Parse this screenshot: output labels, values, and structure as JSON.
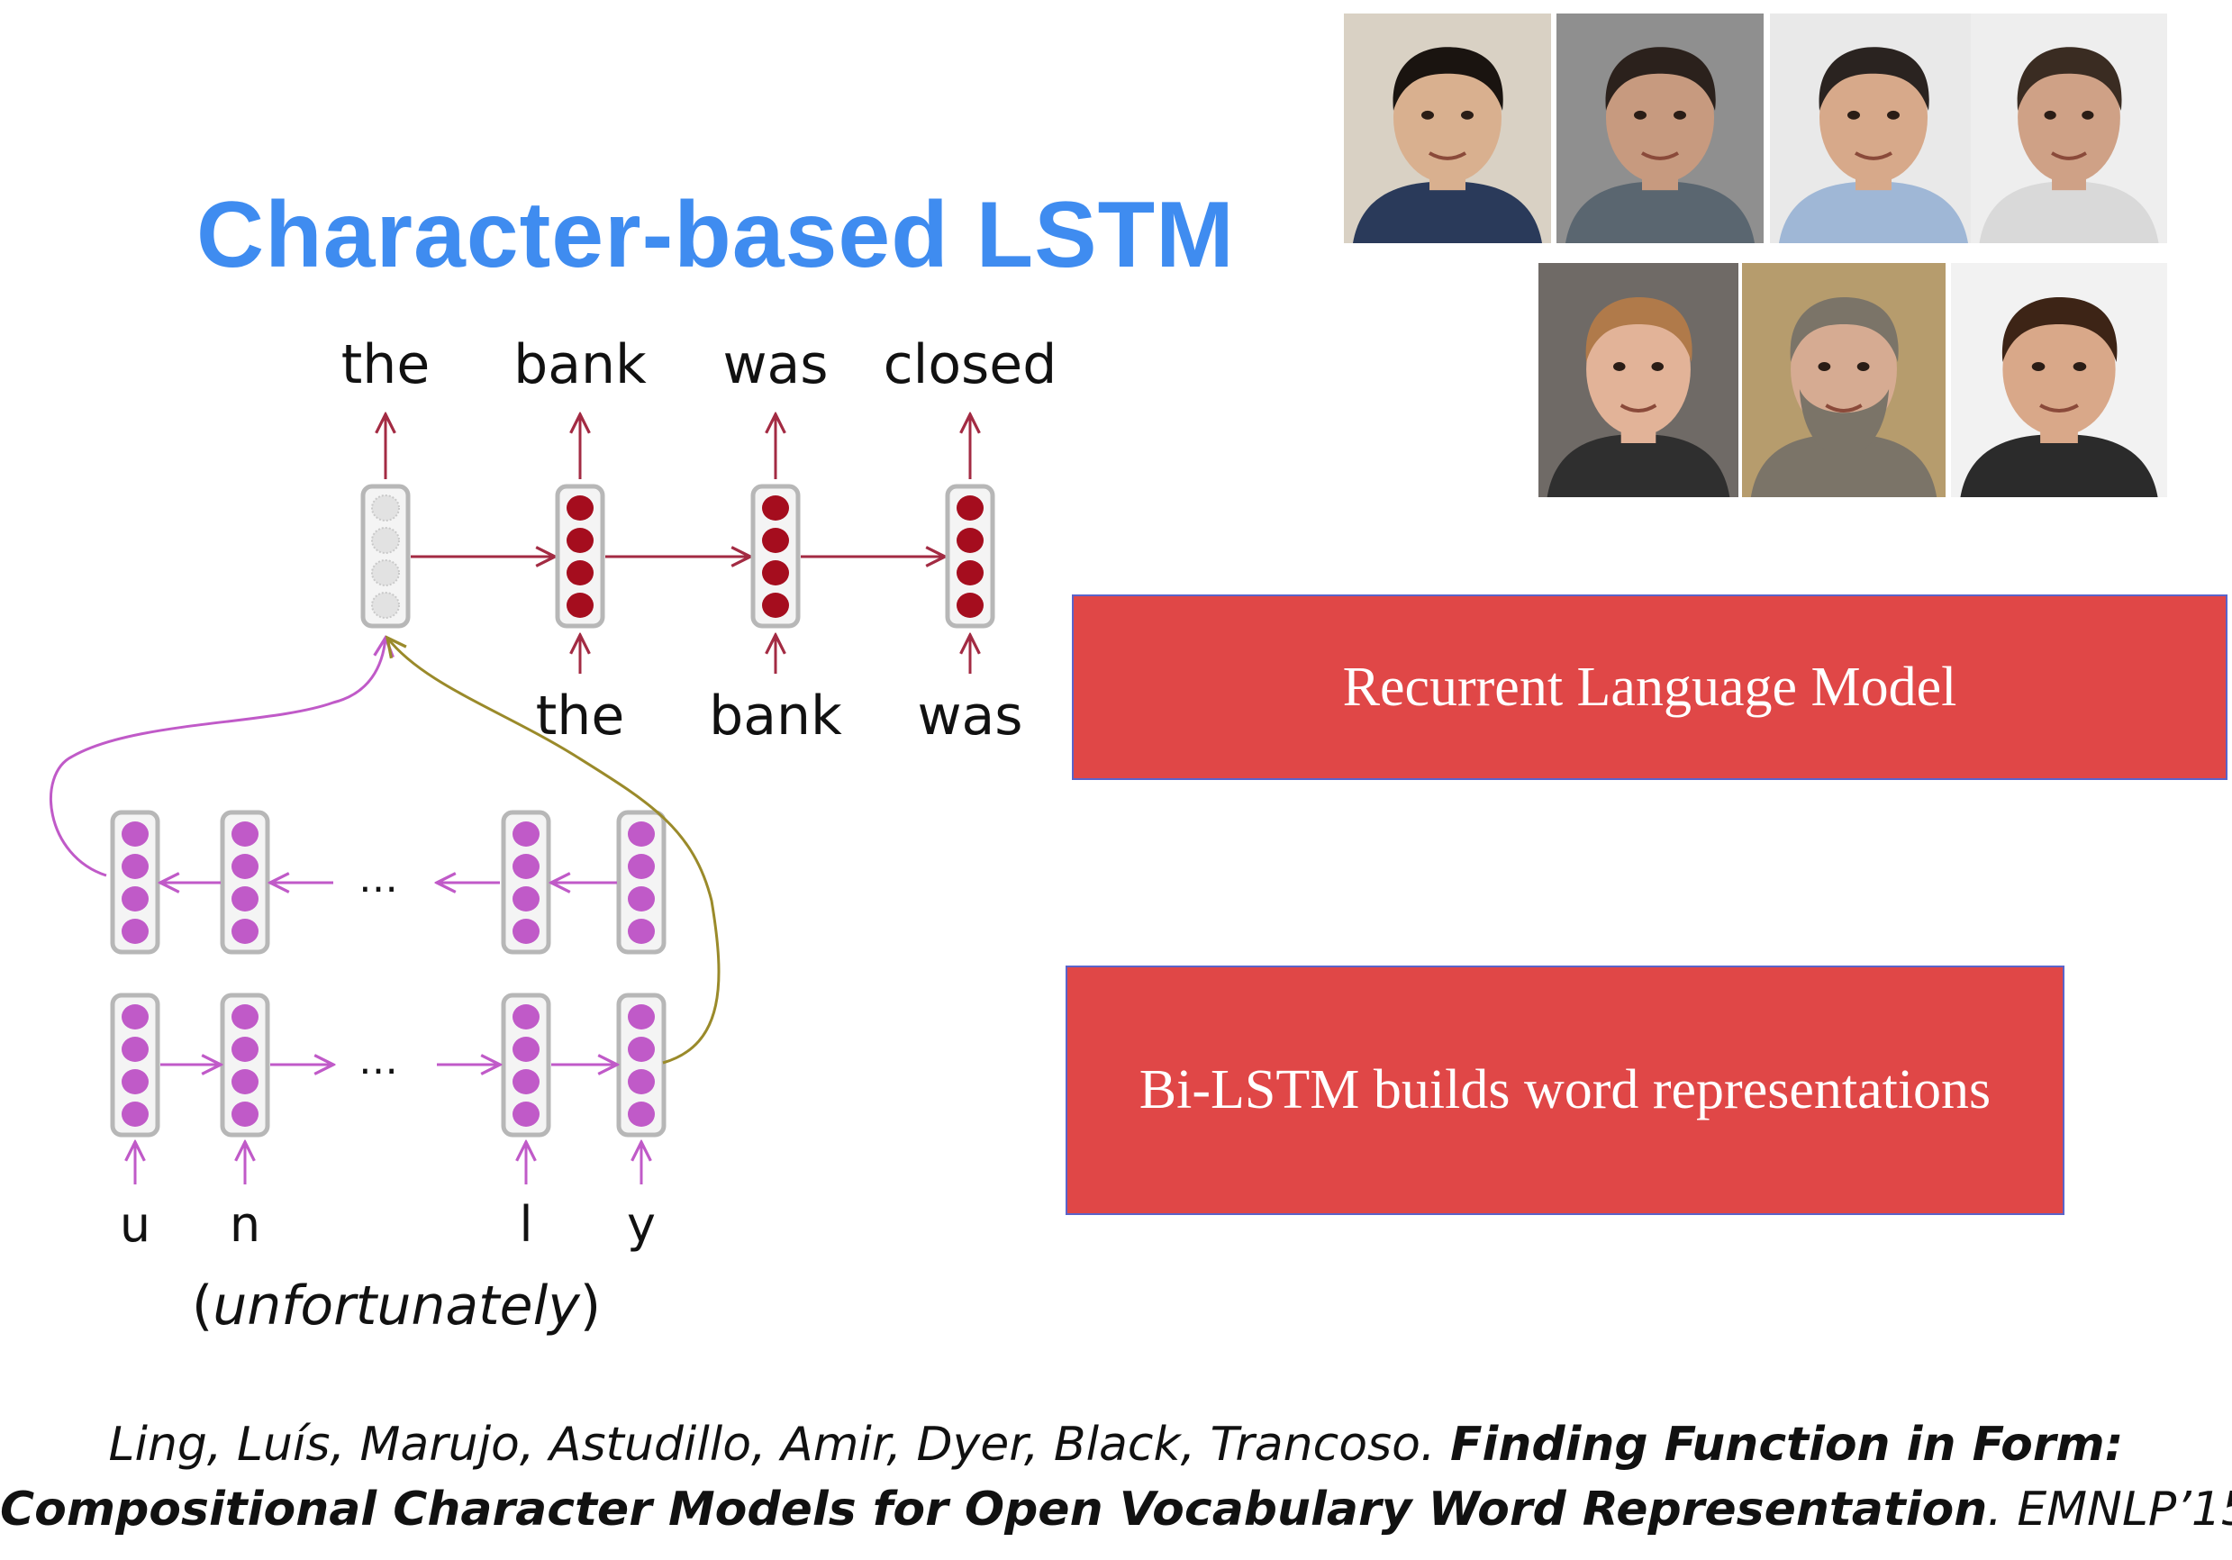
{
  "title": "Character-based LSTM",
  "top_outputs": [
    "the",
    "bank",
    "was",
    "closed"
  ],
  "top_inputs": [
    "the",
    "bank",
    "was"
  ],
  "char_inputs": [
    "u",
    "n",
    "l",
    "y"
  ],
  "ellipsis": "…",
  "word_paren": {
    "open": "(",
    "word": "unfortunately",
    "close": ")"
  },
  "boxes": {
    "recurrent_lm": "Recurrent Language Model",
    "bilstm": "Bi-LSTM builds word representations"
  },
  "citation": {
    "authors": "Ling, Luís, Marujo, Astudillo, Amir, Dyer, Black, Trancoso. ",
    "title_part1": "Finding Function in Form:",
    "title_part2": "Compositional Character Models for Open Vocabulary Word Representation",
    "venue": ". EMNLP’15."
  },
  "colors": {
    "title": "#3f8cf0",
    "box_fill": "#e04747",
    "box_border": "#5b63c9",
    "word_node_dot": "#a50d1e",
    "char_node_dot": "#c05ac8",
    "arrow_word": "#a32b43",
    "arrow_char": "#c05ac8",
    "curve_olive": "#9a8a2a",
    "node_frame": "#b7b7b7"
  },
  "photos": [
    {
      "name": "author-photo-1"
    },
    {
      "name": "author-photo-2"
    },
    {
      "name": "author-photo-3"
    },
    {
      "name": "author-photo-4"
    },
    {
      "name": "author-photo-5"
    },
    {
      "name": "author-photo-6"
    },
    {
      "name": "author-photo-7"
    }
  ]
}
